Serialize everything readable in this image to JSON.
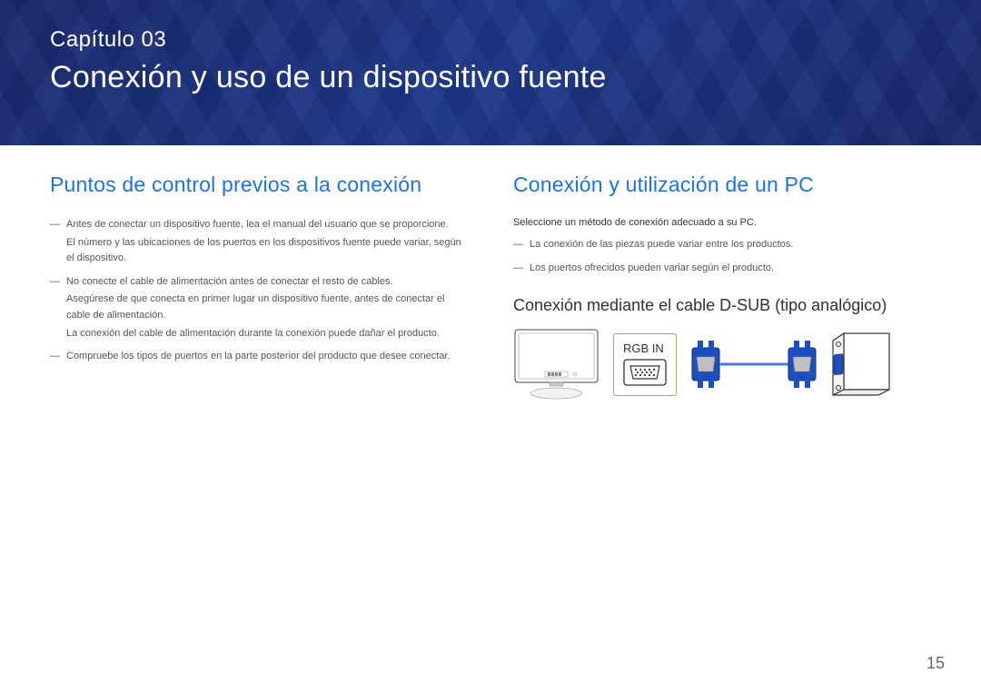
{
  "header": {
    "chapter_label": "Capítulo 03",
    "chapter_title": "Conexión y uso de un dispositivo fuente"
  },
  "left": {
    "heading": "Puntos de control previos a la conexión",
    "items": [
      {
        "main": "Antes de conectar un dispositivo fuente, lea el manual del usuario que se proporcione.",
        "sub": "El número y las ubicaciones de los puertos en los dispositivos fuente puede variar, según el dispositivo."
      },
      {
        "main": "No conecte el cable de alimentación antes de conectar el resto de cables.",
        "sub": "Asegúrese de que conecta en primer lugar un dispositivo fuente, antes de conectar el cable de alimentación.",
        "extra": "La conexión del cable de alimentación durante la conexión puede dañar el producto."
      },
      {
        "main": "Compruebe los tipos de puertos en la parte posterior del producto que desee conectar."
      }
    ]
  },
  "right": {
    "heading": "Conexión y utilización de un PC",
    "intro": "Seleccione un método de conexión adecuado a su PC.",
    "notes": [
      "La conexión de las piezas puede variar entre los productos.",
      "Los puertos ofrecidos pueden variar según el producto."
    ],
    "sub_heading": "Conexión mediante el cable D-SUB (tipo analógico)",
    "port_label": "RGB IN"
  },
  "page_number": "15"
}
